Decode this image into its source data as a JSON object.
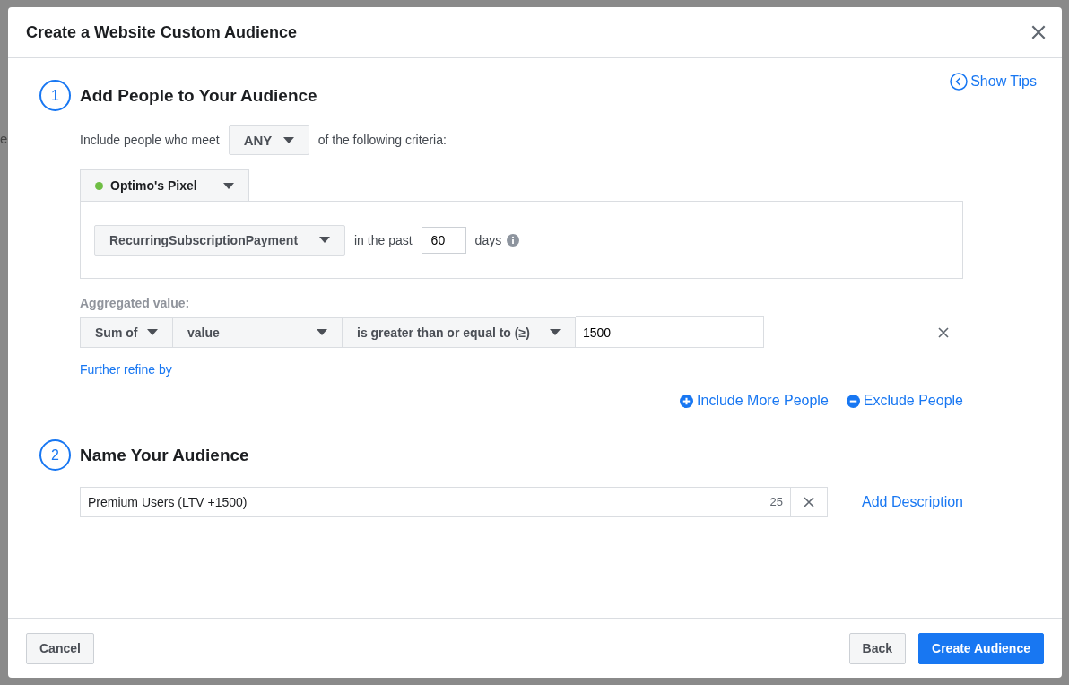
{
  "backdrop_fragment": "e",
  "window": {
    "title": "Create a Website Custom Audience"
  },
  "show_tips": "Show Tips",
  "add_section": {
    "number": "1",
    "title": "Add People to Your Audience",
    "criteria_prefix": "Include people who meet",
    "match_dropdown": "ANY",
    "criteria_suffix": "of the following criteria:",
    "pixel": {
      "name": "Optimo's Pixel",
      "active": true
    },
    "event_dropdown": "RecurringSubscriptionPayment",
    "window_prefix": "in the past",
    "days": "60",
    "days_label": "days",
    "aggregated_label": "Aggregated value:",
    "aggregate": {
      "function": "Sum of",
      "parameter": "value",
      "operator": "is greater than or equal to (≥)",
      "amount": "1500"
    },
    "further_refine": "Further refine by",
    "actions": [
      {
        "label": "Include More People",
        "kind": "include"
      },
      {
        "label": "Exclude People",
        "kind": "exclude"
      }
    ]
  },
  "name_section": {
    "number": "2",
    "title": "Name Your Audience",
    "name_value": "Premium Users (LTV +1500)",
    "char_count": "25",
    "add_description": "Add Description"
  },
  "footer_left": [
    {
      "label": "Cancel",
      "kind": "secondary"
    }
  ],
  "footer_right": [
    {
      "label": "Back",
      "kind": "secondary"
    },
    {
      "label": "Create Audience",
      "kind": "primary"
    }
  ]
}
